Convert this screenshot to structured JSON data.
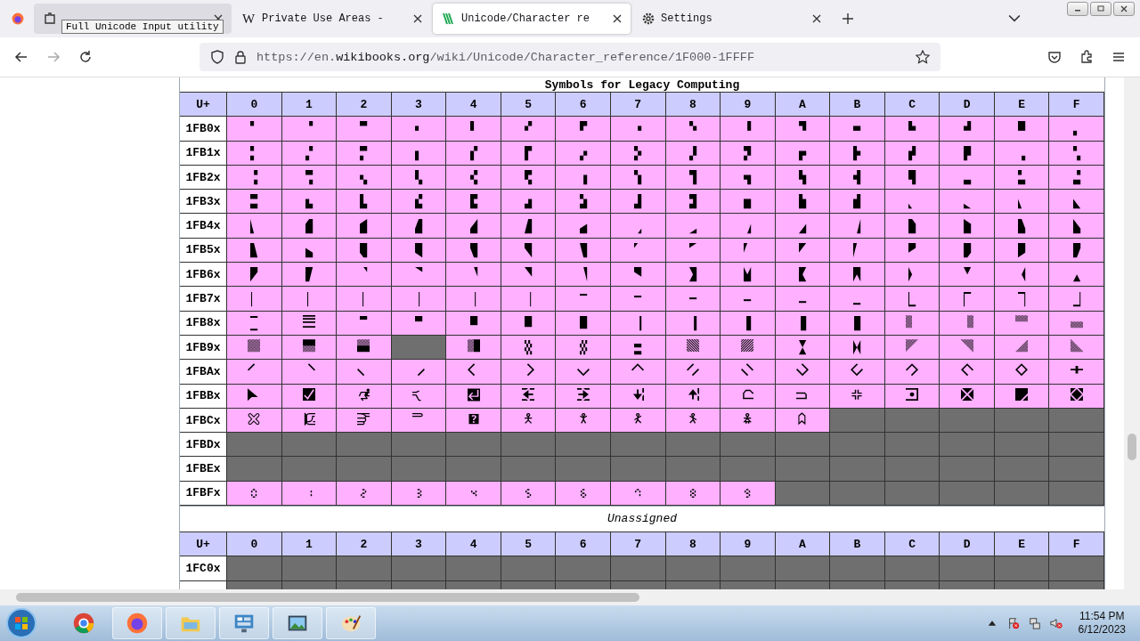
{
  "browser": {
    "tabs": [
      {
        "selected": false
      },
      {
        "favicon": "W",
        "label": "Private Use Areas -",
        "selected": false
      },
      {
        "label": "Unicode/Character re",
        "selected": true
      },
      {
        "label": "Settings",
        "selected": false
      }
    ],
    "tooltip": "Full Unicode Input utility",
    "url": {
      "prefix": "https://en.",
      "host": "wikibooks.org",
      "path": "/wiki/Unicode/Character_reference/1F000-1FFFF"
    }
  },
  "page": {
    "sections": [
      {
        "caption": "Symbols for Legacy Computing",
        "corner": "U+",
        "columns": [
          "0",
          "1",
          "2",
          "3",
          "4",
          "5",
          "6",
          "7",
          "8",
          "9",
          "A",
          "B",
          "C",
          "D",
          "E",
          "F"
        ],
        "rows": [
          {
            "label": "1FB0x",
            "cells": [
              "🬀",
              "🬁",
              "🬂",
              "🬃",
              "🬄",
              "🬅",
              "🬆",
              "🬇",
              "🬈",
              "🬉",
              "🬊",
              "🬋",
              "🬌",
              "🬍",
              "🬎",
              "🬏"
            ]
          },
          {
            "label": "1FB1x",
            "cells": [
              "🬐",
              "🬑",
              "🬒",
              "🬓",
              "🬔",
              "🬕",
              "🬖",
              "🬗",
              "🬘",
              "🬙",
              "🬚",
              "🬛",
              "🬜",
              "🬝",
              "🬞",
              "🬟"
            ]
          },
          {
            "label": "1FB2x",
            "cells": [
              "🬠",
              "🬡",
              "🬢",
              "🬣",
              "🬤",
              "🬥",
              "🬦",
              "🬧",
              "🬨",
              "🬩",
              "🬪",
              "🬫",
              "🬬",
              "🬭",
              "🬮",
              "🬯"
            ]
          },
          {
            "label": "1FB3x",
            "cells": [
              "🬰",
              "🬱",
              "🬲",
              "🬳",
              "🬴",
              "🬵",
              "🬶",
              "🬷",
              "🬸",
              "🬹",
              "🬺",
              "🬻",
              "🬼",
              "🬽",
              "🬾",
              "🬿"
            ]
          },
          {
            "label": "1FB4x",
            "cells": [
              "🭀",
              "🭁",
              "🭂",
              "🭃",
              "🭄",
              "🭅",
              "🭆",
              "🭇",
              "🭈",
              "🭉",
              "🭊",
              "🭋",
              "🭌",
              "🭍",
              "🭎",
              "🭏"
            ]
          },
          {
            "label": "1FB5x",
            "cells": [
              "🭐",
              "🭑",
              "🭒",
              "🭓",
              "🭔",
              "🭕",
              "🭖",
              "🭗",
              "🭘",
              "🭙",
              "🭚",
              "🭛",
              "🭜",
              "🭝",
              "🭞",
              "🭟"
            ]
          },
          {
            "label": "1FB6x",
            "cells": [
              "🭠",
              "🭡",
              "🭢",
              "🭣",
              "🭤",
              "🭥",
              "🭦",
              "🭧",
              "🭨",
              "🭩",
              "🭪",
              "🭫",
              "🭬",
              "🭭",
              "🭮",
              "🭯"
            ]
          },
          {
            "label": "1FB7x",
            "cells": [
              "🭰",
              "🭱",
              "🭲",
              "🭳",
              "🭴",
              "🭵",
              "🭶",
              "🭷",
              "🭸",
              "🭹",
              "🭺",
              "🭻",
              "🭼",
              "🭽",
              "🭾",
              "🭿"
            ]
          },
          {
            "label": "1FB8x",
            "cells": [
              "🮀",
              "🮁",
              "🮂",
              "🮃",
              "🮄",
              "🮅",
              "🮆",
              "🮇",
              "🮈",
              "🮉",
              "🮊",
              "🮋",
              "🮌",
              "🮍",
              "🮎",
              "🮏"
            ]
          },
          {
            "label": "1FB9x",
            "cells": [
              "🮐",
              "🮑",
              "🮒",
              null,
              "🮔",
              "🮕",
              "🮖",
              "🮗",
              "🮘",
              "🮙",
              "🮚",
              "🮛",
              "🮜",
              "🮝",
              "🮞",
              "🮟"
            ]
          },
          {
            "label": "1FBAx",
            "cells": [
              "🮠",
              "🮡",
              "🮢",
              "🮣",
              "🮤",
              "🮥",
              "🮦",
              "🮧",
              "🮨",
              "🮩",
              "🮪",
              "🮫",
              "🮬",
              "🮭",
              "🮮",
              "🮯"
            ]
          },
          {
            "label": "1FBBx",
            "cells": [
              "🮰",
              "🮱",
              "🮲",
              "🮳",
              "🮴",
              "🮵",
              "🮶",
              "🮷",
              "🮸",
              "🮹",
              "🮺",
              "🮻",
              "🮼",
              "🮽",
              "🮾",
              "🮿"
            ]
          },
          {
            "label": "1FBCx",
            "cells": [
              "🯀",
              "🯁",
              "🯂",
              "🯃",
              "🯄",
              "🯅",
              "🯆",
              "🯇",
              "🯈",
              "🯉",
              "🯊",
              null,
              null,
              null,
              null,
              null
            ]
          },
          {
            "label": "1FBDx",
            "cells": [
              null,
              null,
              null,
              null,
              null,
              null,
              null,
              null,
              null,
              null,
              null,
              null,
              null,
              null,
              null,
              null
            ]
          },
          {
            "label": "1FBEx",
            "cells": [
              null,
              null,
              null,
              null,
              null,
              null,
              null,
              null,
              null,
              null,
              null,
              null,
              null,
              null,
              null,
              null
            ]
          },
          {
            "label": "1FBFx",
            "cells": [
              "🯰",
              "🯱",
              "🯲",
              "🯳",
              "🯴",
              "🯵",
              "🯶",
              "🯷",
              "🯸",
              "🯹",
              null,
              null,
              null,
              null,
              null,
              null
            ]
          }
        ]
      },
      {
        "caption": "Unassigned",
        "corner": "U+",
        "columns": [
          "0",
          "1",
          "2",
          "3",
          "4",
          "5",
          "6",
          "7",
          "8",
          "9",
          "A",
          "B",
          "C",
          "D",
          "E",
          "F"
        ],
        "rows": [
          {
            "label": "1FC0x",
            "cells": [
              null,
              null,
              null,
              null,
              null,
              null,
              null,
              null,
              null,
              null,
              null,
              null,
              null,
              null,
              null,
              null
            ]
          }
        ]
      }
    ]
  },
  "taskbar": {
    "time": "11:54 PM",
    "date": "6/12/2023"
  }
}
